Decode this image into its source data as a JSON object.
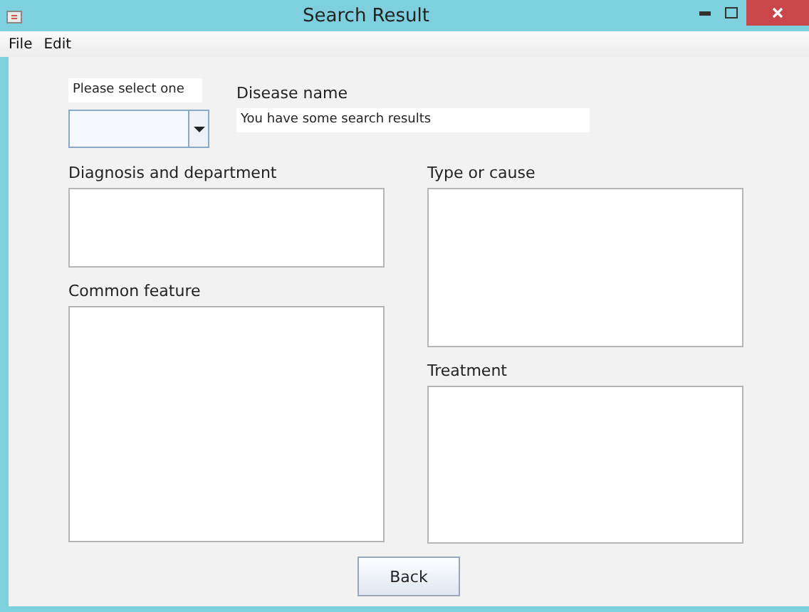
{
  "window": {
    "title": "Search Result"
  },
  "menu": [
    "File",
    "Edit"
  ],
  "select": {
    "label": "Please select one"
  },
  "disease": {
    "label": "Disease name",
    "value": "You have some search results"
  },
  "areas": [
    {
      "label": "Diagnosis and department"
    },
    {
      "label": "Common feature"
    },
    {
      "label": "Type or cause"
    },
    {
      "label": "Treatment"
    }
  ],
  "buttons": [
    "Back"
  ]
}
